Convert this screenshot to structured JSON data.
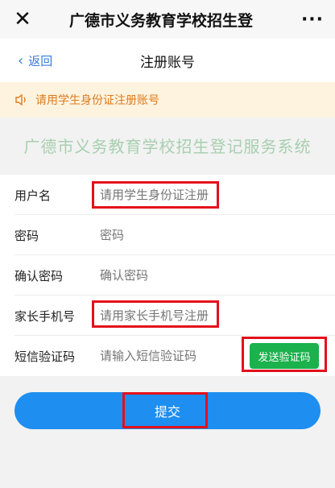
{
  "wechat_bar": {
    "close_icon": "close-icon",
    "title": "广德市义务教育学校招生登",
    "more_icon": "more-icon"
  },
  "nav": {
    "back_label": "返回",
    "page_title": "注册账号"
  },
  "notice": {
    "icon": "speaker-icon",
    "text": "请用学生身份证注册账号",
    "color": "#e07b1a"
  },
  "system_title": "广德市义务教育学校招生登记服务系统",
  "form": {
    "username": {
      "label": "用户名",
      "placeholder": "请用学生身份证注册"
    },
    "password": {
      "label": "密码",
      "placeholder": "密码"
    },
    "confirm_password": {
      "label": "确认密码",
      "placeholder": "确认密码"
    },
    "parent_phone": {
      "label": "家长手机号",
      "placeholder": "请用家长手机号注册"
    },
    "sms_code": {
      "label": "短信验证码",
      "placeholder": "请输入短信验证码",
      "send_button": "发送验证码"
    }
  },
  "submit_label": "提交",
  "colors": {
    "accent_blue": "#1e8ef0",
    "send_green": "#1bb14c",
    "highlight_red": "#e4101a"
  }
}
